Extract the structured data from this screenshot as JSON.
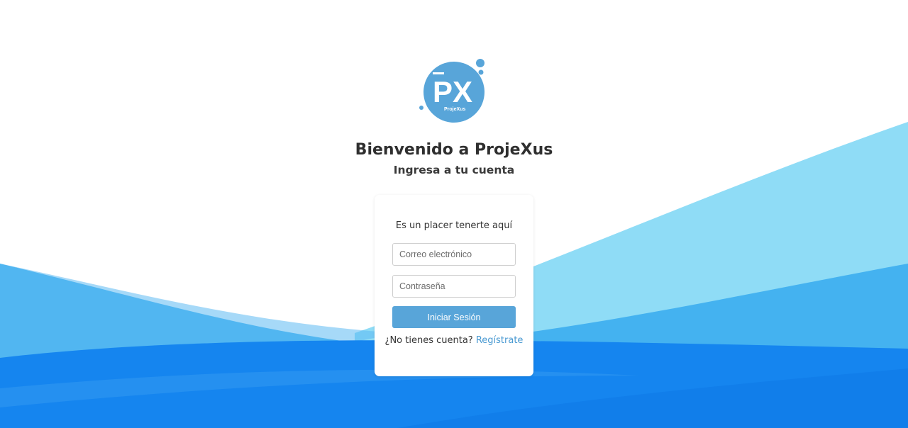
{
  "header": {
    "title": "Bienvenido a ProjeXus",
    "subtitle": "Ingresa a tu cuenta"
  },
  "logo": {
    "initials": "PX",
    "wordmark": "ProjeXus",
    "color": "#58a5d9"
  },
  "login_card": {
    "welcome": "Es un placer tenerte aquí",
    "email_placeholder": "Correo electrónico",
    "email_value": "",
    "password_placeholder": "Contraseña",
    "password_value": "",
    "submit_label": "Iniciar Sesión",
    "signup_prompt": "¿No tienes cuenta?",
    "signup_link": "Regístrate"
  },
  "colors": {
    "accent": "#58a5d9",
    "link": "#4a9ad2",
    "heading": "#2f2f2f",
    "wave_light": "#8fdcf6",
    "wave_mid": "#3ab3ef",
    "wave_dark": "#1482ee"
  }
}
